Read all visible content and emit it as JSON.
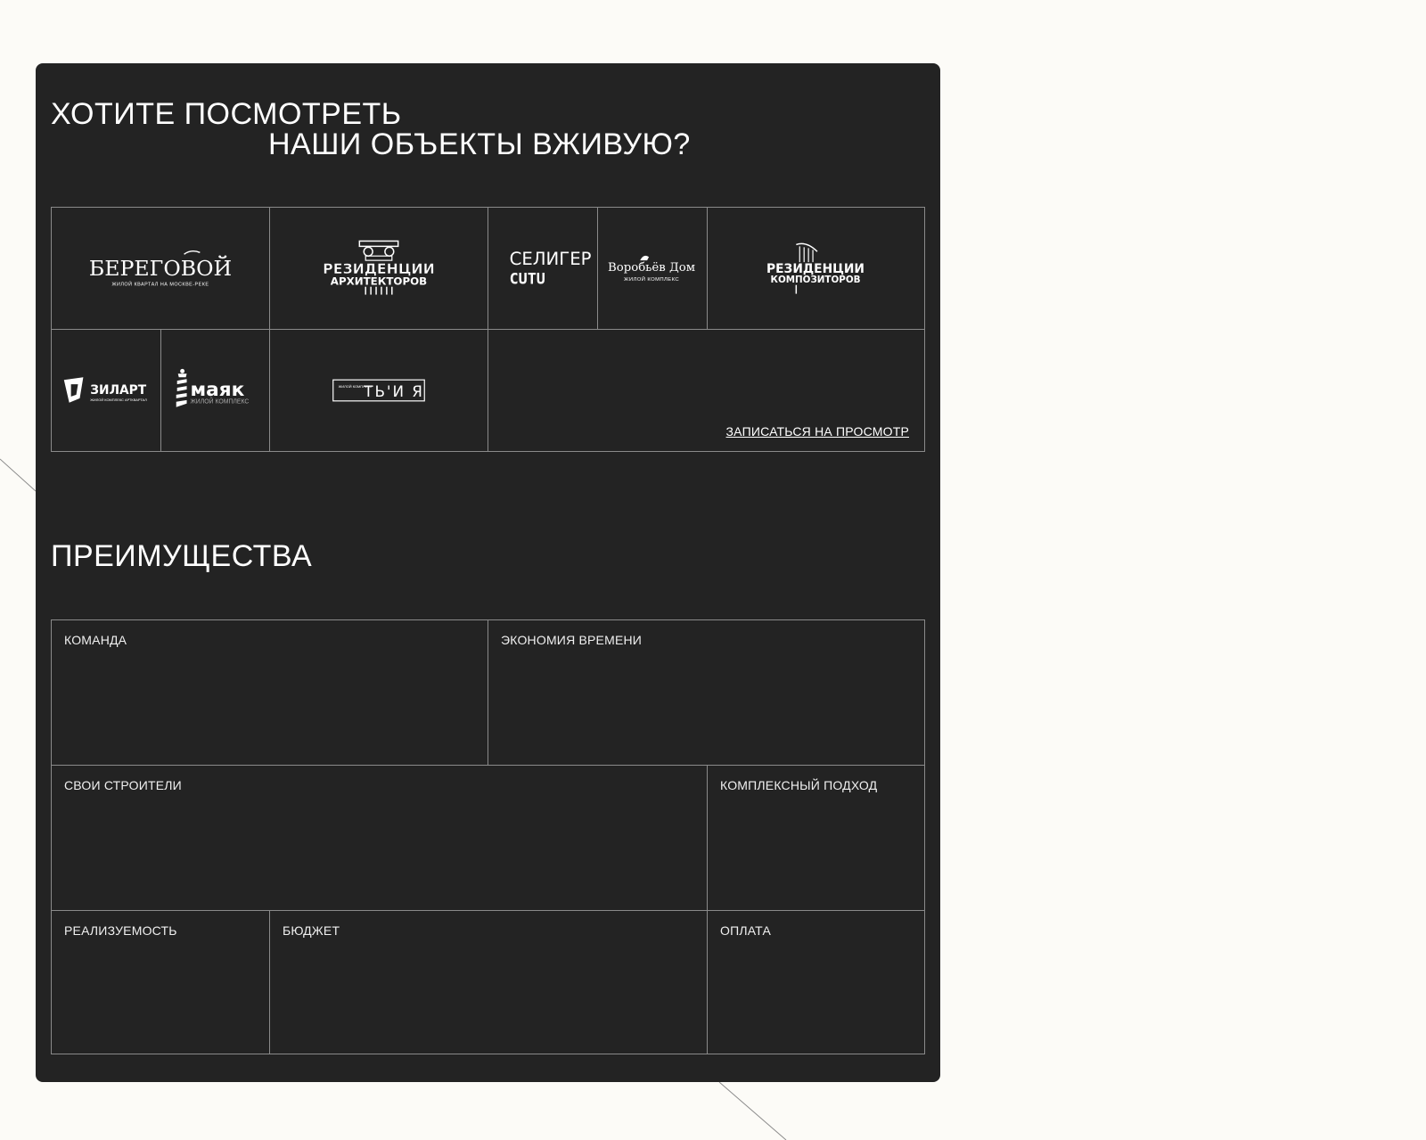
{
  "viewing": {
    "title_line1": "ХОТИТЕ ПОСМОТРЕТЬ",
    "title_line2": "НАШИ ОБЪЕКТЫ ВЖИВУЮ?",
    "cta_label": "ЗАПИСАТЬСЯ НА ПРОСМОТР",
    "logos": [
      {
        "icon": "beregovoy-logo",
        "text": "БЕРЕГОВОЙ",
        "subtext": "ЖИЛОЙ КВАРТАЛ НА МОСКВЕ-РЕКЕ"
      },
      {
        "icon": "rezidentsii-arkhitektorov-logo",
        "text": "РЕЗИДЕНЦИИ",
        "subtext": "АРХИТЕКТОРОВ"
      },
      {
        "icon": "seliger-siti-logo",
        "text": "СЕЛИГЕР",
        "subtext": "CUTU"
      },
      {
        "icon": "vorobyov-dom-logo",
        "text": "Воробьёв Дом",
        "subtext": "ЖИЛОЙ КОМПЛЕКС"
      },
      {
        "icon": "rezidentsii-kompozitorov-logo",
        "text": "РЕЗИДЕНЦИИ",
        "subtext": "КОМПОЗИТОРОВ"
      },
      {
        "icon": "zilart-logo",
        "text": "ЗИЛАРТ",
        "subtext": "ЖИЛОЙ КОМПЛЕКС АРТКВАРТАЛ"
      },
      {
        "icon": "mayak-logo",
        "text": "маяк",
        "subtext": "ЖИЛОЙ КОМПЛЕКС"
      },
      {
        "icon": "tyuya-logo",
        "text": "ТЬ'И Я",
        "subtext": "ЖИЛОЙ КОМПЛЕКС"
      }
    ]
  },
  "advantages": {
    "title": "ПРЕИМУЩЕСТВА",
    "items": [
      {
        "label": "КОМАНДА"
      },
      {
        "label": "ЭКОНОМИЯ ВРЕМЕНИ"
      },
      {
        "label": "СВОИ СТРОИТЕЛИ"
      },
      {
        "label": "КОМПЛЕКСНЫЙ ПОДХОД"
      },
      {
        "label": "РЕАЛИЗУЕМОСТЬ"
      },
      {
        "label": "БЮДЖЕТ"
      },
      {
        "label": "ОПЛАТА"
      }
    ]
  }
}
